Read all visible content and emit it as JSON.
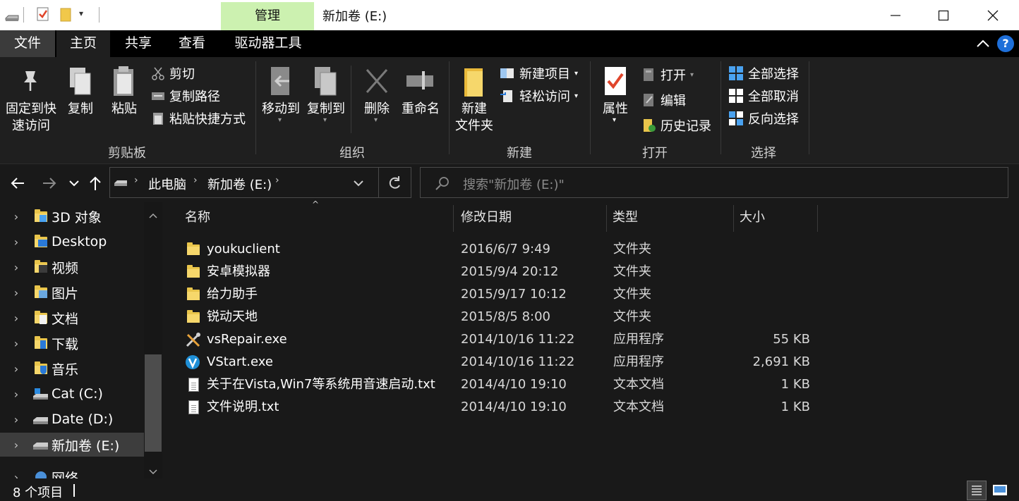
{
  "title_bar": {
    "context_tab": "管理",
    "window_title": "新加卷 (E:)"
  },
  "ribbon_tabs": [
    "文件",
    "主页",
    "共享",
    "查看",
    "驱动器工具"
  ],
  "ribbon": {
    "clipboard": {
      "pin_label_1": "固定到快",
      "pin_label_2": "速访问",
      "copy": "复制",
      "paste": "粘贴",
      "cut": "剪切",
      "copy_path": "复制路径",
      "paste_shortcut": "粘贴快捷方式",
      "group": "剪贴板"
    },
    "organize": {
      "move_to": "移动到",
      "copy_to": "复制到",
      "delete": "删除",
      "rename": "重命名",
      "group": "组织"
    },
    "new": {
      "new_folder_1": "新建",
      "new_folder_2": "文件夹",
      "new_item": "新建项目",
      "easy_access": "轻松访问",
      "group": "新建"
    },
    "open": {
      "properties": "属性",
      "open": "打开",
      "edit": "编辑",
      "history": "历史记录",
      "group": "打开"
    },
    "select": {
      "select_all": "全部选择",
      "select_none": "全部取消",
      "invert": "反向选择",
      "group": "选择"
    }
  },
  "address": {
    "crumb_1": "此电脑",
    "crumb_2": "新加卷 (E:)",
    "search_placeholder": "搜索\"新加卷 (E:)\""
  },
  "nav_pane": {
    "items": [
      {
        "label": "3D 对象",
        "icon": "3d-objects-icon"
      },
      {
        "label": "Desktop",
        "icon": "desktop-folder-icon"
      },
      {
        "label": "视频",
        "icon": "videos-folder-icon"
      },
      {
        "label": "图片",
        "icon": "pictures-folder-icon"
      },
      {
        "label": "文档",
        "icon": "documents-folder-icon"
      },
      {
        "label": "下载",
        "icon": "downloads-folder-icon"
      },
      {
        "label": "音乐",
        "icon": "music-folder-icon"
      },
      {
        "label": "Cat (C:)",
        "icon": "windows-drive-icon"
      },
      {
        "label": "Date (D:)",
        "icon": "drive-icon"
      },
      {
        "label": "新加卷 (E:)",
        "icon": "drive-icon",
        "selected": true
      },
      {
        "label": "网络",
        "icon": "network-icon"
      }
    ]
  },
  "file_list": {
    "columns": [
      "名称",
      "修改日期",
      "类型",
      "大小"
    ],
    "rows": [
      {
        "name": "youkuclient",
        "date": "2016/6/7 9:49",
        "type": "文件夹",
        "size": "",
        "icon": "folder-icon"
      },
      {
        "name": "安卓模拟器",
        "date": "2015/9/4 20:12",
        "type": "文件夹",
        "size": "",
        "icon": "folder-icon"
      },
      {
        "name": "给力助手",
        "date": "2015/9/17 10:12",
        "type": "文件夹",
        "size": "",
        "icon": "folder-icon"
      },
      {
        "name": "锐动天地",
        "date": "2015/8/5 8:00",
        "type": "文件夹",
        "size": "",
        "icon": "folder-icon"
      },
      {
        "name": "vsRepair.exe",
        "date": "2014/10/16 11:22",
        "type": "应用程序",
        "size": "55 KB",
        "icon": "tools-icon"
      },
      {
        "name": "VStart.exe",
        "date": "2014/10/16 11:22",
        "type": "应用程序",
        "size": "2,691 KB",
        "icon": "vstart-app-icon"
      },
      {
        "name": "关于在Vista,Win7等系统用音速启动.txt",
        "date": "2014/4/10 19:10",
        "type": "文本文档",
        "size": "1 KB",
        "icon": "text-file-icon"
      },
      {
        "name": "文件说明.txt",
        "date": "2014/4/10 19:10",
        "type": "文本文档",
        "size": "1 KB",
        "icon": "text-file-icon"
      }
    ]
  },
  "status_bar": {
    "item_count": "8 个项目"
  },
  "colors": {
    "background": "#191919",
    "ribbon": "#1f1f1f",
    "manage_tab": "#ccf1b0",
    "folder": "#e9c54b",
    "help": "#1e6fd9"
  }
}
